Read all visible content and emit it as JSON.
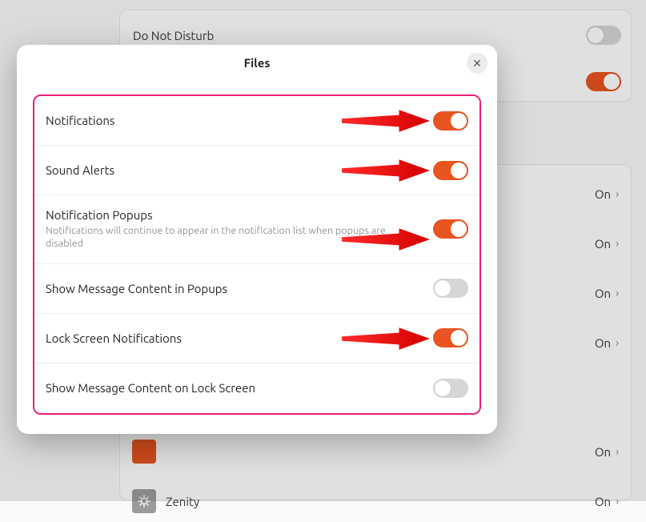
{
  "background": {
    "dnd_label": "Do Not Disturb",
    "dnd_on": false,
    "second_toggle_on": true,
    "apps": [
      {
        "name": "",
        "status": "On"
      },
      {
        "name": "",
        "status": "On"
      },
      {
        "name": "",
        "status": "On"
      },
      {
        "name": "",
        "status": "On"
      },
      {
        "name": "",
        "status": "On"
      },
      {
        "name": "Zenity",
        "status": "On"
      }
    ]
  },
  "dialog": {
    "title": "Files",
    "close_glyph": "✕",
    "settings": [
      {
        "label": "Notifications",
        "desc": "",
        "on": true,
        "arrow": true
      },
      {
        "label": "Sound Alerts",
        "desc": "",
        "on": true,
        "arrow": true
      },
      {
        "label": "Notification Popups",
        "desc": "Notifications will continue to appear in the notification list when popups are disabled",
        "on": true,
        "arrow": true,
        "arrow_low": true
      },
      {
        "label": "Show Message Content in Popups",
        "desc": "",
        "on": false,
        "arrow": false
      },
      {
        "label": "Lock Screen Notifications",
        "desc": "",
        "on": true,
        "arrow": true
      },
      {
        "label": "Show Message Content on Lock Screen",
        "desc": "",
        "on": false,
        "arrow": false
      }
    ]
  },
  "colors": {
    "accent": "#e95420",
    "highlight_border": "#ec1e79",
    "arrow": "#fd0606"
  }
}
